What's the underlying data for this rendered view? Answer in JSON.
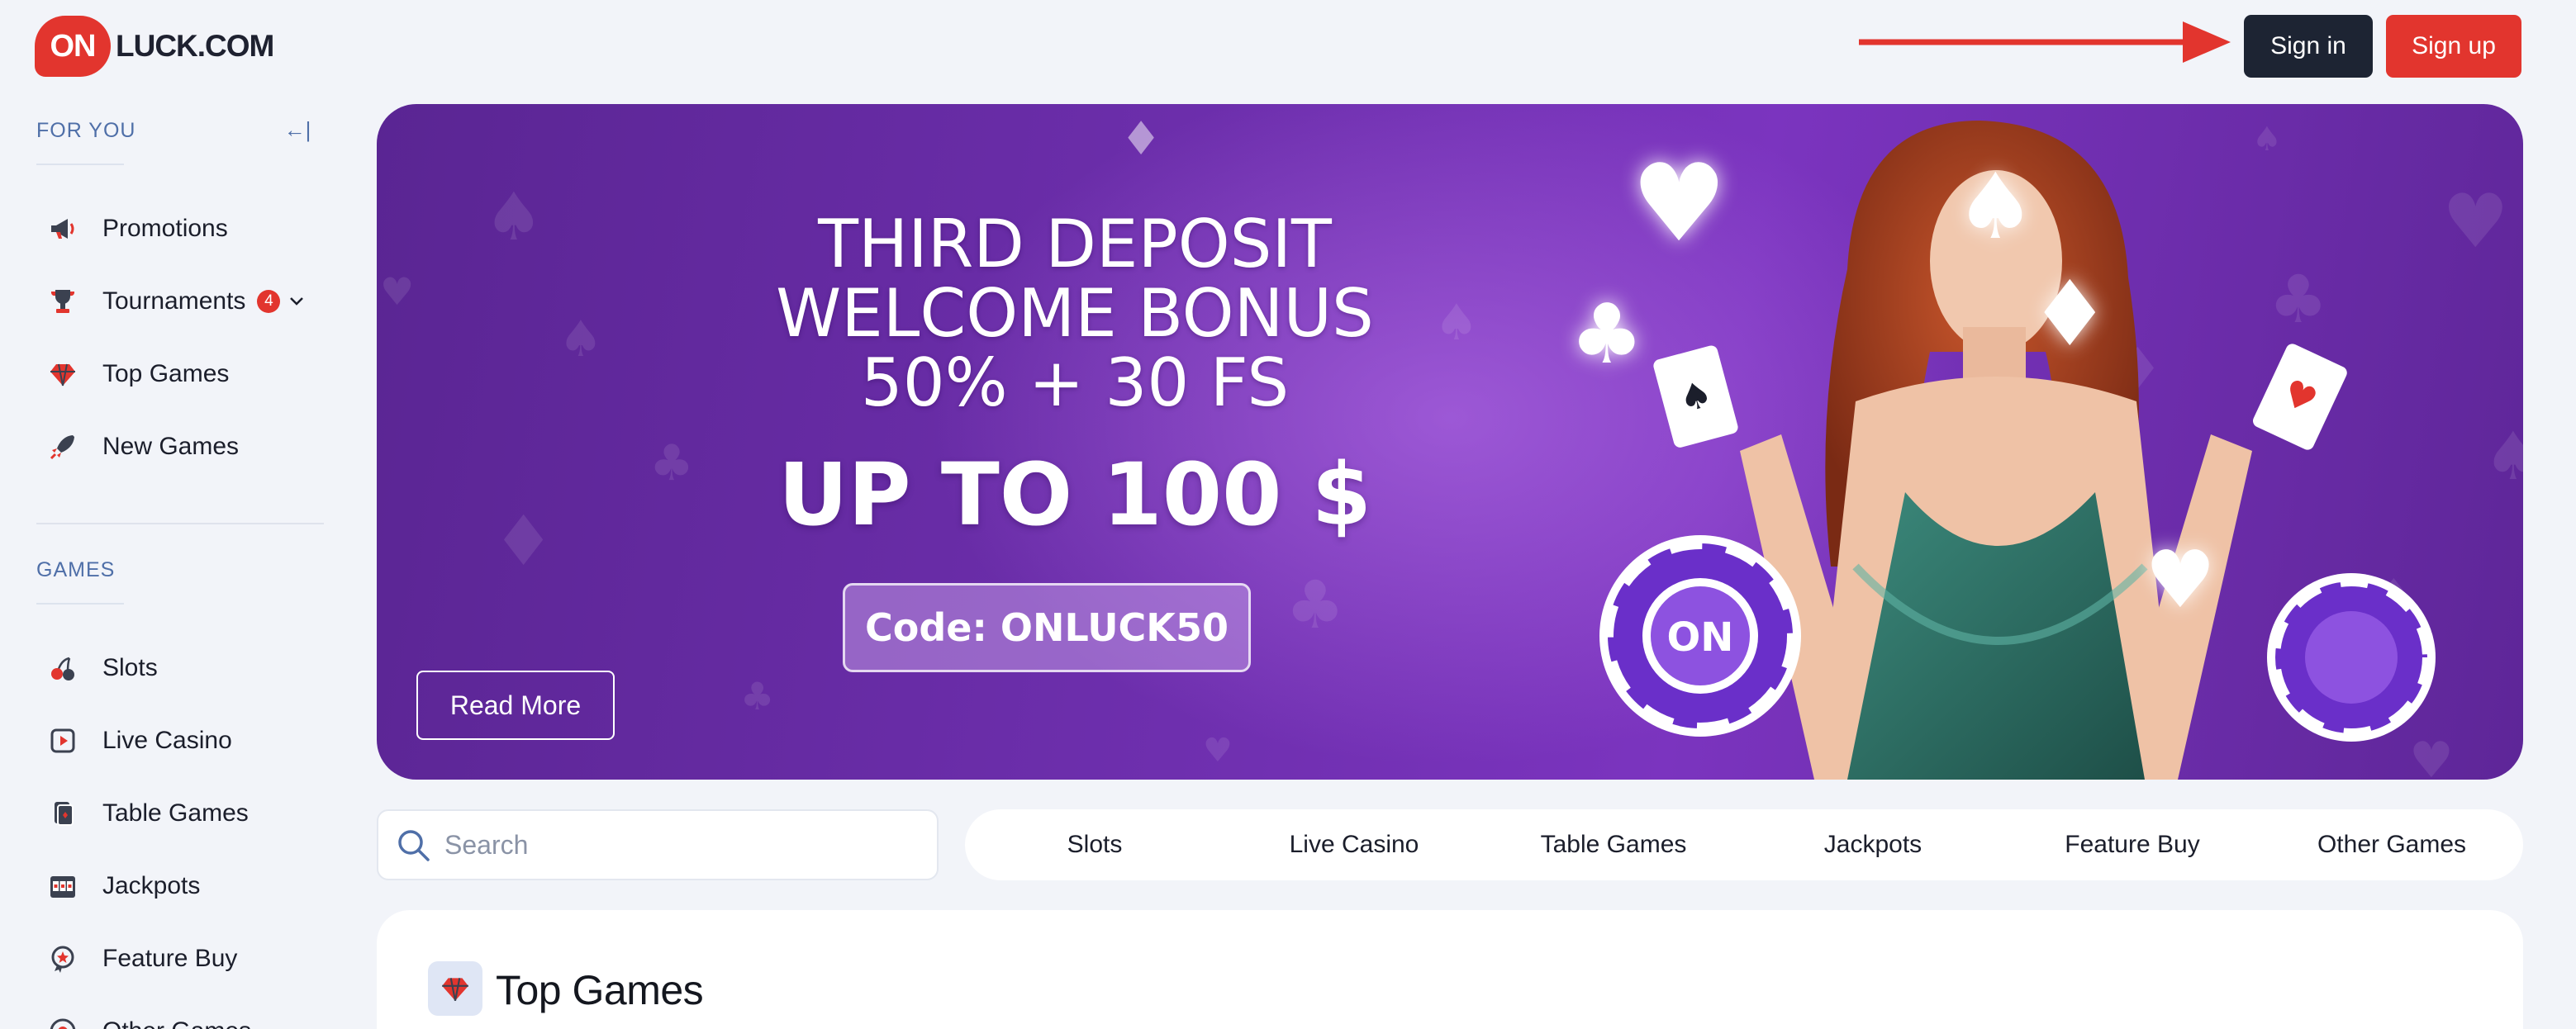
{
  "brand": {
    "badge": "ON",
    "name": "LUCK.COM"
  },
  "header": {
    "signin_label": "Sign in",
    "signup_label": "Sign up"
  },
  "sidebar": {
    "for_you_heading": "FOR YOU",
    "collapse_glyph": "←|",
    "for_you_items": [
      {
        "label": "Promotions",
        "icon": "megaphone-icon"
      },
      {
        "label": "Tournaments",
        "icon": "trophy-icon",
        "badge": "4"
      },
      {
        "label": "Top Games",
        "icon": "diamond-icon"
      },
      {
        "label": "New Games",
        "icon": "rocket-icon"
      }
    ],
    "games_heading": "GAMES",
    "games_items": [
      {
        "label": "Slots",
        "icon": "cherries-icon"
      },
      {
        "label": "Live Casino",
        "icon": "play-icon"
      },
      {
        "label": "Table Games",
        "icon": "cards-icon"
      },
      {
        "label": "Jackpots",
        "icon": "slot-machine-icon"
      },
      {
        "label": "Feature Buy",
        "icon": "star-badge-icon"
      },
      {
        "label": "Other Games",
        "icon": "roulette-icon"
      }
    ]
  },
  "banner": {
    "title_line1": "THIRD DEPOSIT",
    "title_line2": "WELCOME BONUS",
    "title_line3": "50% + 30 FS",
    "amount": "UP TO 100 $",
    "code": "Code: ONLUCK50",
    "cta": "Read More",
    "chip_text": "ON"
  },
  "search": {
    "placeholder": "Search"
  },
  "filters": [
    "Slots",
    "Live Casino",
    "Table Games",
    "Jackpots",
    "Feature Buy",
    "Other Games"
  ],
  "section": {
    "title": "Top Games"
  },
  "colors": {
    "brand_red": "#e2352e",
    "dark": "#1d2433",
    "banner_purple": "#6e2fae",
    "sidebar_heading": "#4f6fa8"
  }
}
